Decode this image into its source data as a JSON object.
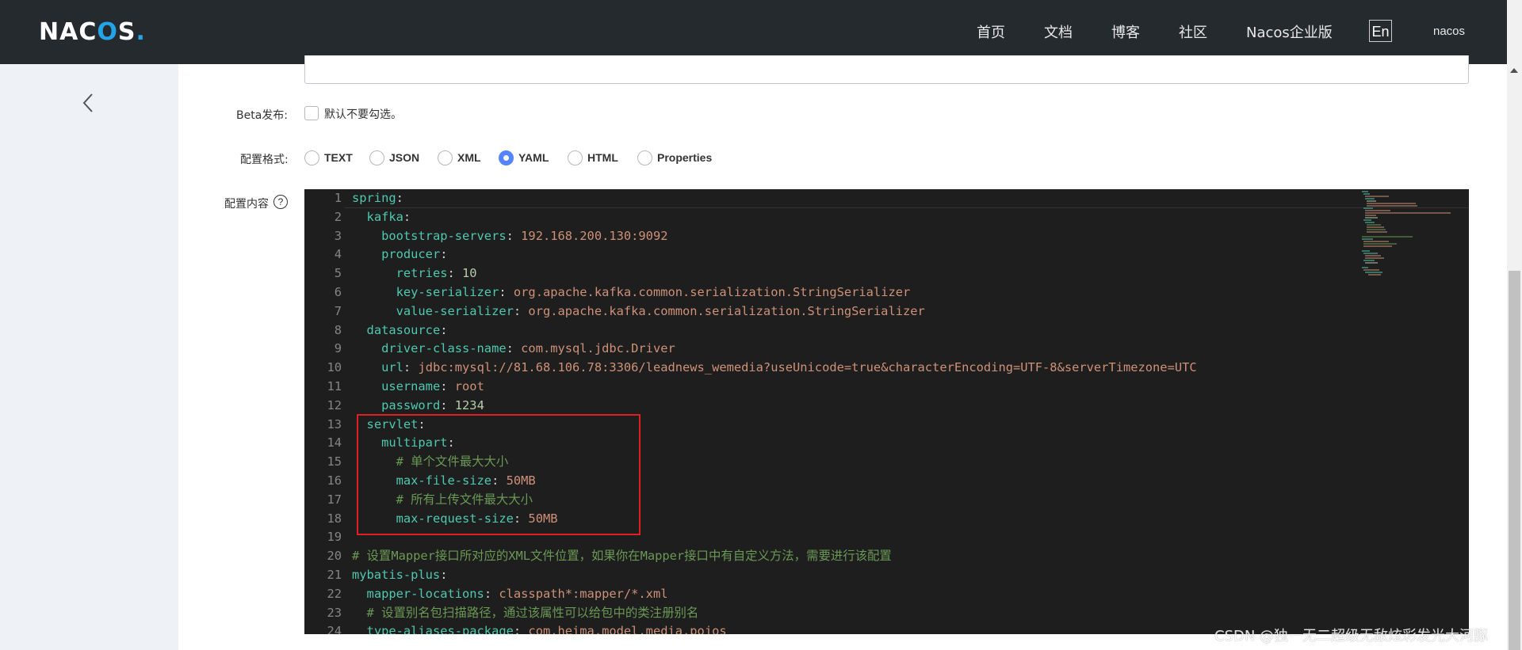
{
  "header": {
    "logo": {
      "part1": "NAC",
      "part2": "O",
      "part3": "S",
      "dot": "."
    },
    "nav": [
      "首页",
      "文档",
      "博客",
      "社区",
      "Nacos企业版"
    ],
    "lang": "En",
    "user": "nacos"
  },
  "form": {
    "beta_label": "Beta发布:",
    "beta_checkbox_text": "默认不要勾选。",
    "format_label": "配置格式:",
    "formats": [
      "TEXT",
      "JSON",
      "XML",
      "YAML",
      "HTML",
      "Properties"
    ],
    "selected_format": "YAML",
    "content_label": "配置内容",
    "help_icon": "?"
  },
  "editor": {
    "lines": [
      {
        "n": "1",
        "html": "spring"
      },
      {
        "n": "2"
      },
      {
        "n": "3"
      },
      {
        "n": "4"
      },
      {
        "n": "5"
      },
      {
        "n": "6"
      },
      {
        "n": "7"
      },
      {
        "n": "8"
      },
      {
        "n": "9"
      },
      {
        "n": "10"
      },
      {
        "n": "11"
      },
      {
        "n": "12"
      },
      {
        "n": "13"
      },
      {
        "n": "14"
      },
      {
        "n": "15"
      },
      {
        "n": "16"
      },
      {
        "n": "17"
      },
      {
        "n": "18"
      },
      {
        "n": "19"
      },
      {
        "n": "20"
      },
      {
        "n": "21"
      },
      {
        "n": "22"
      },
      {
        "n": "23"
      },
      {
        "n": "24"
      }
    ],
    "tokens": {
      "l1": [
        [
          "k",
          "spring"
        ],
        [
          "p",
          ":"
        ]
      ],
      "l2": [
        [
          "p",
          "  "
        ],
        [
          "k",
          "kafka"
        ],
        [
          "p",
          ":"
        ]
      ],
      "l3": [
        [
          "p",
          "    "
        ],
        [
          "k",
          "bootstrap-servers"
        ],
        [
          "p",
          ": "
        ],
        [
          "s",
          "192.168.200.130:9092"
        ]
      ],
      "l4": [
        [
          "p",
          "    "
        ],
        [
          "k",
          "producer"
        ],
        [
          "p",
          ":"
        ]
      ],
      "l5": [
        [
          "p",
          "      "
        ],
        [
          "k",
          "retries"
        ],
        [
          "p",
          ": "
        ],
        [
          "n",
          "10"
        ]
      ],
      "l6": [
        [
          "p",
          "      "
        ],
        [
          "k",
          "key-serializer"
        ],
        [
          "p",
          ": "
        ],
        [
          "s",
          "org.apache.kafka.common.serialization.StringSerializer"
        ]
      ],
      "l7": [
        [
          "p",
          "      "
        ],
        [
          "k",
          "value-serializer"
        ],
        [
          "p",
          ": "
        ],
        [
          "s",
          "org.apache.kafka.common.serialization.StringSerializer"
        ]
      ],
      "l8": [
        [
          "p",
          "  "
        ],
        [
          "k",
          "datasource"
        ],
        [
          "p",
          ":"
        ]
      ],
      "l9": [
        [
          "p",
          "    "
        ],
        [
          "k",
          "driver-class-name"
        ],
        [
          "p",
          ": "
        ],
        [
          "s",
          "com.mysql.jdbc.Driver"
        ]
      ],
      "l10": [
        [
          "p",
          "    "
        ],
        [
          "k",
          "url"
        ],
        [
          "p",
          ": "
        ],
        [
          "s",
          "jdbc:mysql://81.68.106.78:3306/leadnews_wemedia?useUnicode=true&characterEncoding=UTF-8&serverTimezone=UTC"
        ]
      ],
      "l11": [
        [
          "p",
          "    "
        ],
        [
          "k",
          "username"
        ],
        [
          "p",
          ": "
        ],
        [
          "s",
          "root"
        ]
      ],
      "l12": [
        [
          "p",
          "    "
        ],
        [
          "k",
          "password"
        ],
        [
          "p",
          ": "
        ],
        [
          "n",
          "1234"
        ]
      ],
      "l13": [
        [
          "p",
          "  "
        ],
        [
          "k",
          "servlet"
        ],
        [
          "p",
          ":"
        ]
      ],
      "l14": [
        [
          "p",
          "    "
        ],
        [
          "k",
          "multipart"
        ],
        [
          "p",
          ":"
        ]
      ],
      "l15": [
        [
          "p",
          "      "
        ],
        [
          "c",
          "# 单个文件最大大小"
        ]
      ],
      "l16": [
        [
          "p",
          "      "
        ],
        [
          "k",
          "max-file-size"
        ],
        [
          "p",
          ": "
        ],
        [
          "s",
          "50MB"
        ]
      ],
      "l17": [
        [
          "p",
          "      "
        ],
        [
          "c",
          "# 所有上传文件最大大小"
        ]
      ],
      "l18": [
        [
          "p",
          "      "
        ],
        [
          "k",
          "max-request-size"
        ],
        [
          "p",
          ": "
        ],
        [
          "s",
          "50MB"
        ]
      ],
      "l19": [],
      "l20": [
        [
          "c",
          "# 设置Mapper接口所对应的XML文件位置，如果你在Mapper接口中有自定义方法，需要进行该配置"
        ]
      ],
      "l21": [
        [
          "k",
          "mybatis-plus"
        ],
        [
          "p",
          ":"
        ]
      ],
      "l22": [
        [
          "p",
          "  "
        ],
        [
          "k",
          "mapper-locations"
        ],
        [
          "p",
          ": "
        ],
        [
          "s",
          "classpath*:mapper/*.xml"
        ]
      ],
      "l23": [
        [
          "p",
          "  "
        ],
        [
          "c",
          "# 设置别名包扫描路径，通过该属性可以给包中的类注册别名"
        ]
      ],
      "l24": [
        [
          "p",
          "  "
        ],
        [
          "k",
          "type-aliases-package"
        ],
        [
          "p",
          ": "
        ],
        [
          "s",
          "com.heima.model.media.pojos"
        ]
      ]
    }
  },
  "watermark": "CSDN @独一无二超级无敌炫彩发光大河豚",
  "colors": {
    "header_bg": "#252a2f",
    "accent": "#5584ff",
    "editor_bg": "#1e1e1e",
    "highlight": "#e02020"
  }
}
